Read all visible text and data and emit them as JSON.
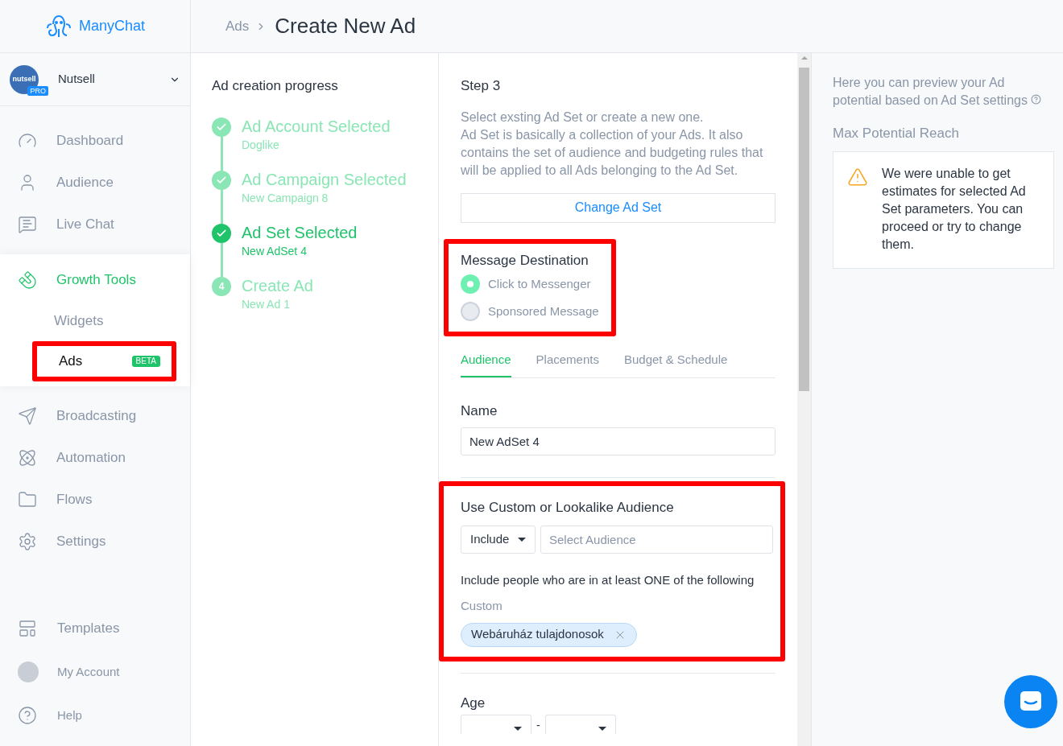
{
  "app": {
    "logo": "ManyChat"
  },
  "account": {
    "avatar_text": "nutsell",
    "plan": "PRO",
    "name": "Nutsell"
  },
  "nav": [
    {
      "label": "Dashboard",
      "kind": "dashboard",
      "selected": false
    },
    {
      "label": "Audience",
      "kind": "audience",
      "selected": false
    },
    {
      "label": "Live Chat",
      "kind": "chat",
      "selected": false
    },
    {
      "label": "Growth Tools",
      "kind": "growth",
      "selected": true,
      "children": [
        {
          "label": "Widgets",
          "selected": false,
          "highlighted": false
        },
        {
          "label": "Ads",
          "badge": "BETA",
          "selected": true,
          "highlighted": true
        }
      ]
    },
    {
      "label": "Broadcasting",
      "kind": "broadcast",
      "selected": false
    },
    {
      "label": "Automation",
      "kind": "automation",
      "selected": false
    },
    {
      "label": "Flows",
      "kind": "flows",
      "selected": false
    },
    {
      "label": "Settings",
      "kind": "settings",
      "selected": false
    }
  ],
  "nav_bottom": [
    {
      "label": "Templates",
      "kind": "templates"
    },
    {
      "label": "My Account",
      "kind": "avatar"
    },
    {
      "label": "Help",
      "kind": "help"
    }
  ],
  "breadcrumb": {
    "parent": "Ads",
    "title": "Create New Ad"
  },
  "progress": {
    "title": "Ad creation progress",
    "steps": [
      {
        "title": "Ad Account Selected",
        "subtitle": "Doglike",
        "kind": "done"
      },
      {
        "title": "Ad Campaign Selected",
        "subtitle": "New Campaign 8",
        "kind": "done"
      },
      {
        "title": "Ad Set Selected",
        "subtitle": "New AdSet 4",
        "kind": "current"
      },
      {
        "title": "Create Ad",
        "subtitle": "New Ad 1",
        "kind": "pending",
        "number": "4"
      }
    ]
  },
  "step": {
    "title": "Step 3",
    "intro": "Select exsting Ad Set or create a new one.",
    "description": "Ad Set is basically a collection of your Ads. It also contains the set of audience and budgeting rules that will be applied to all Ads belonging to the Ad Set.",
    "button": "Change Ad Set"
  },
  "message_destination": {
    "title": "Message Destination",
    "highlighted": true,
    "options": [
      {
        "label": "Click to Messenger",
        "selected": true
      },
      {
        "label": "Sponsored Message",
        "selected": false
      }
    ]
  },
  "tabs": [
    {
      "label": "Audience",
      "selected": true
    },
    {
      "label": "Placements",
      "selected": false
    },
    {
      "label": "Budget & Schedule",
      "selected": false
    }
  ],
  "name_field": {
    "label": "Name",
    "value": "New AdSet 4"
  },
  "custom_audience": {
    "title": "Use Custom or Lookalike Audience",
    "highlighted": true,
    "mode": "Include",
    "placeholder": "Select Audience",
    "rule": "Include people who are in at least ONE of the following",
    "group": "Custom",
    "tags": [
      "Webáruház tulajdonosok"
    ]
  },
  "age": {
    "label": "Age",
    "separator": "-"
  },
  "preview": {
    "intro": "Here you can preview your Ad potential based on Ad Set settings",
    "reach_title": "Max Potential Reach",
    "warning": "We were unable to get estimates for selected Ad Set parameters. You can proceed or try to change them."
  }
}
